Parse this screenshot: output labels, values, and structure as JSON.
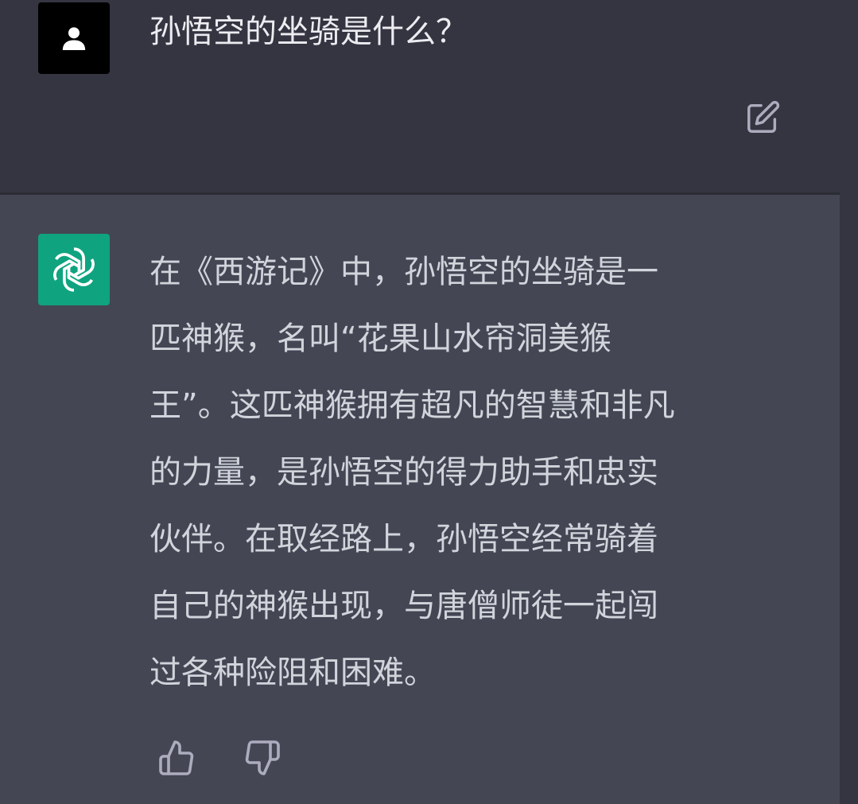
{
  "user_message": {
    "text": "孙悟空的坐骑是什么？",
    "avatar_icon": "user-silhouette-icon",
    "edit_icon": "edit-icon"
  },
  "assistant_message": {
    "avatar_icon": "openai-logo-icon",
    "lines": [
      "在《西游记》中，孙悟空的坐骑是一",
      "匹神猴，名叫“花果山水帘洞美猴",
      "王”。这匹神猴拥有超凡的智慧和非凡",
      "的力量，是孙悟空的得力助手和忠实",
      "伙伴。在取经路上，孙悟空经常骑着",
      "自己的神猴出现，与唐僧师徒一起闯",
      "过各种险阻和困难。"
    ],
    "feedback": {
      "thumbs_up_icon": "thumbs-up-icon",
      "thumbs_down_icon": "thumbs-down-icon"
    }
  },
  "colors": {
    "user_bg": "#343541",
    "assistant_bg": "#444654",
    "brand_green": "#10a37f",
    "text_primary": "#ececf1",
    "text_secondary": "#d1d5db",
    "icon_gray": "#acacbe"
  }
}
